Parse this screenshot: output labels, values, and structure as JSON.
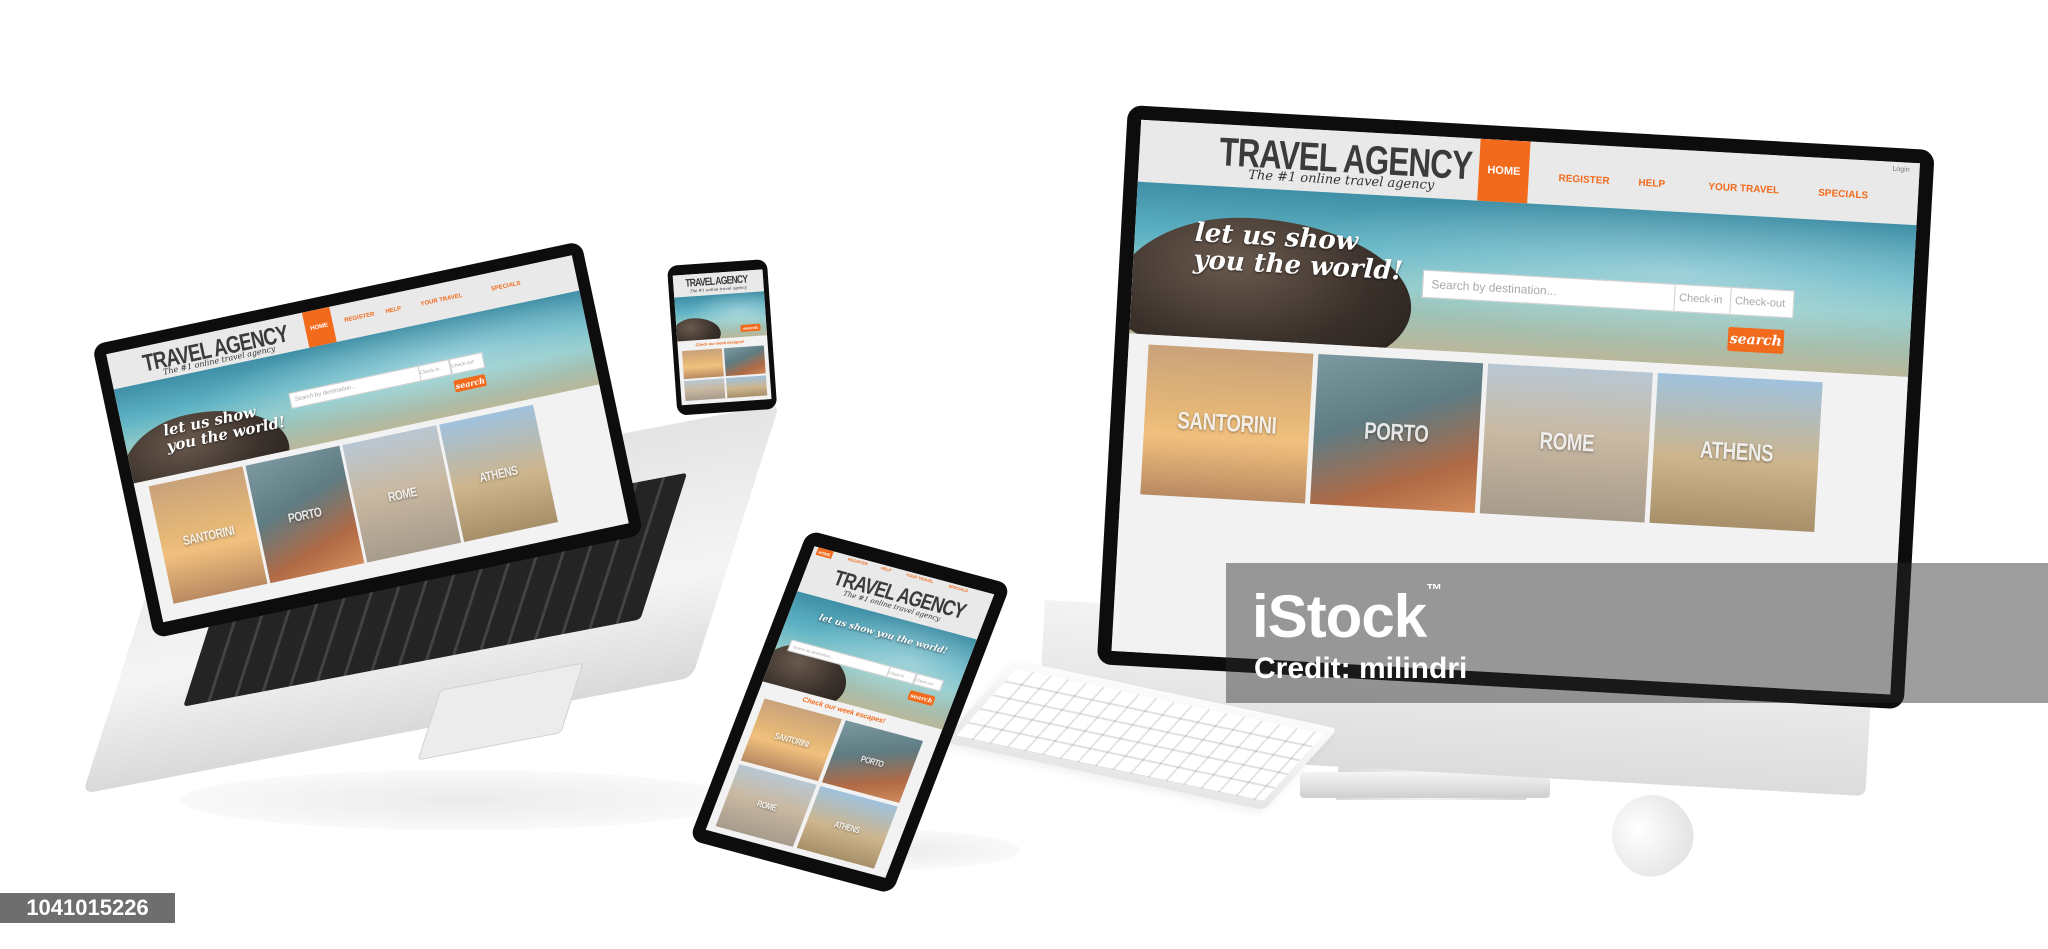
{
  "site": {
    "title": "TRAVEL AGENCY",
    "tagline": "The #1 online travel agency",
    "nav": [
      "HOME",
      "REGISTER",
      "HELP",
      "YOUR TRAVEL",
      "SPECIALS"
    ],
    "login": "Login",
    "hero_line1": "let us show",
    "hero_line2": "you the world!",
    "search_placeholder": "Search by destination...",
    "checkin": "Check-in",
    "checkout": "Check-out",
    "search_button": "search",
    "promo": "Check our week escapes!",
    "destinations": [
      "SANTORINI",
      "PORTO",
      "ROME",
      "ATHENS"
    ]
  },
  "watermark": {
    "brand": "iStock",
    "tm": "™",
    "credit": "Credit: milindri",
    "image_number": "1041015226"
  },
  "colors": {
    "accent": "#f26b1d",
    "bezel": "#0d0d0d",
    "header_bg": "#e9e9e9"
  }
}
